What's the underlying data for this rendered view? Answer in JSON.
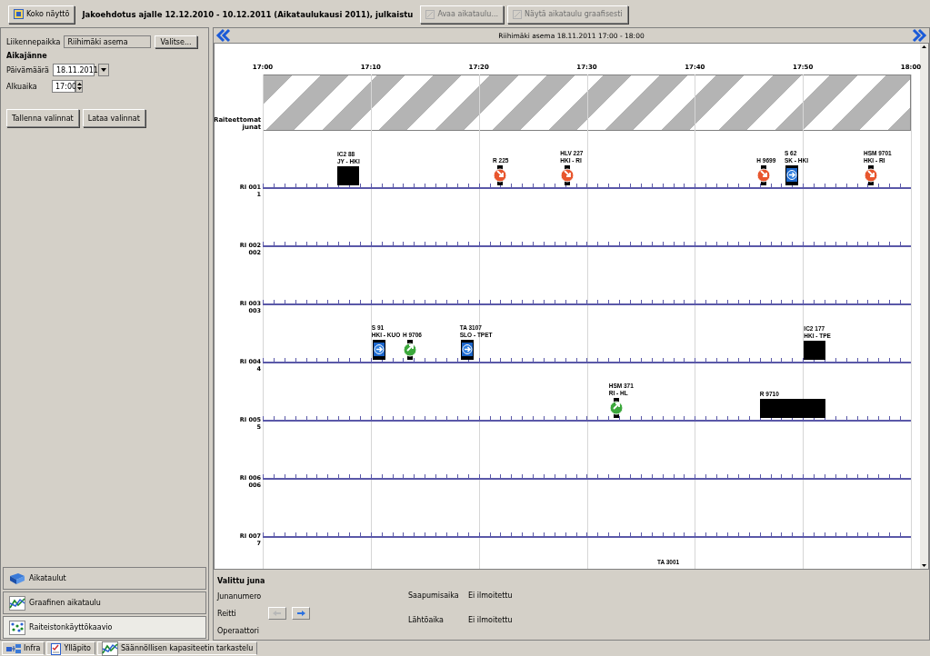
{
  "toolbar": {
    "full_screen_button": "Koko näyttö",
    "title": "Jakoehdotus ajalle 12.12.2010 - 10.12.2011 (Aikataulukausi 2011), julkaistu",
    "buttons": [
      {
        "label": "Avaa aikataulu...",
        "disabled": true
      },
      {
        "label": "Näytä aikataulu graafisesti",
        "disabled": true
      }
    ]
  },
  "filters": {
    "location_label": "Liikennepaikka",
    "location_value": "Riihimäki asema",
    "choose_button": "Valitse...",
    "section": "Aikajänne",
    "date_label": "Päivämäärä",
    "date_value": "18.11.2011",
    "start_label": "Alkuaika",
    "start_value": "17:00",
    "save_button": "Tallenna valinnat",
    "load_button": "Lataa valinnat"
  },
  "nav": [
    {
      "label": "Aikataulut",
      "kind": "book",
      "selected": false
    },
    {
      "label": "Graafinen aikataulu",
      "kind": "graph",
      "selected": false
    },
    {
      "label": "Raiteistonkäyttökaavio",
      "kind": "dots",
      "selected": true
    }
  ],
  "chart": {
    "title": "Riihimäki asema 18.11.2011 17:00 - 18:00",
    "times": [
      "17:00",
      "17:10",
      "17:20",
      "17:30",
      "17:40",
      "17:50",
      "18:00"
    ],
    "trackless_label": "Raiteettomat junat",
    "tracks": [
      {
        "name": "RI 001",
        "number": "1",
        "trains": [
          {
            "kind": "block",
            "name": "IC2 88",
            "route": "JY - HKI",
            "level": 0.115
          },
          {
            "kind": "departure",
            "name": "R 225",
            "level": 0.355
          },
          {
            "kind": "departure",
            "name": "HLV 227",
            "route": "HKI - RI",
            "level": 0.459
          },
          {
            "kind": "departure",
            "name": "H 9699",
            "level": 0.762
          },
          {
            "kind": "through",
            "name": "S 62",
            "route": "SK - HKI",
            "level": 0.805
          },
          {
            "kind": "departure",
            "name": "HSM 9701",
            "route": "HKI - RI",
            "level": 0.927
          }
        ]
      },
      {
        "name": "RI 002",
        "number": "002"
      },
      {
        "name": "RI 003",
        "number": "003"
      },
      {
        "name": "RI 004",
        "number": "4",
        "trains": [
          {
            "kind": "through",
            "name": "S 91",
            "route": "HKI - KUO",
            "level": 0.168
          },
          {
            "kind": "arrival",
            "name": "H 9706",
            "level": 0.216
          },
          {
            "kind": "through",
            "name": "TA 3107",
            "route": "SLO - TPET",
            "level": 0.304
          },
          {
            "kind": "block",
            "name": "IC2 177",
            "route": "HKI - TPE",
            "level": 0.835
          }
        ]
      },
      {
        "name": "RI 005",
        "number": "5",
        "trains": [
          {
            "kind": "arrival",
            "name": "HSM 371",
            "route": "RI - HL",
            "level": 0.534
          },
          {
            "kind": "wide-block",
            "name": "R 9710",
            "level": 0.767
          }
        ]
      },
      {
        "name": "RI 006",
        "number": "006"
      },
      {
        "name": "RI 007",
        "number": "7"
      }
    ],
    "cut_off_trains": [
      {
        "name": "TA 3001"
      }
    ]
  },
  "selected_train": {
    "title": "Valittu juna",
    "number_label": "Junanumero",
    "route_label": "Reitti",
    "operator_label": "Operaattori",
    "route_buttons": [
      {
        "kind": "back",
        "disabled": true
      },
      {
        "kind": "forward",
        "disabled": false
      }
    ],
    "arrival_label": "Saapumisaika",
    "arrival_value": "Ei ilmoitettu",
    "departure_label": "Lähtöaika",
    "departure_value": "Ei ilmoitettu"
  },
  "bottom_tabs": [
    {
      "label": "Infra",
      "kind": "infra"
    },
    {
      "label": "Ylläpito",
      "kind": "admin"
    },
    {
      "label": "Säännöllisen kapasiteetin tarkastelu",
      "kind": "graph"
    }
  ]
}
